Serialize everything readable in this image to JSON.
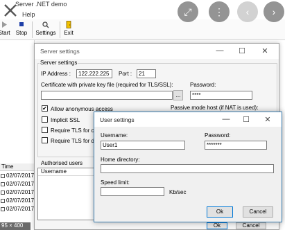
{
  "app": {
    "title": "Server .NET demo",
    "menu_help": "Help",
    "toolbar": {
      "start": "Start",
      "stop": "Stop",
      "settings": "Settings",
      "exit": "Exit"
    },
    "log": {
      "time_header": "Time",
      "rows": [
        "02/07/2017",
        "02/07/2017",
        "02/07/2017",
        "02/07/2017",
        "02/07/2017"
      ]
    },
    "size_tag": "95 × 400"
  },
  "server_settings": {
    "title": "Server settings",
    "group_label": "Server settings",
    "ip_label": "IP Address :",
    "ip_value": "122.222.225",
    "port_label": "Port :",
    "port_value": "21",
    "cert_label": "Certificate with private key file (required for TLS/SSL):",
    "cert_value": "",
    "browse_label": "...",
    "cert_password_label": "Password:",
    "cert_password_value": "****",
    "anon_label": "Allow anonymous access",
    "anon_checked": "✔",
    "passive_label": "Passive mode host (if NAT is used):",
    "implicit_label": "Implicit SSL",
    "require_tls_1": "Require TLS for c",
    "require_tls_2": "Require TLS for d",
    "users_label": "Authorised users",
    "users_column": "Username",
    "ok_label": "Ok",
    "cancel_label": "Cancel"
  },
  "user_settings": {
    "title": "User settings",
    "username_label": "Username:",
    "username_value": "User1",
    "password_label": "Password:",
    "password_value": "*******",
    "home_label": "Home directory:",
    "home_value": "",
    "speed_label": "Speed limit:",
    "speed_value": "",
    "speed_unit": "Kb/sec",
    "ok_label": "Ok",
    "cancel_label": "Cancel"
  },
  "colors": {
    "focus_border": "#0078d7",
    "dialog_border": "#3c7fb1",
    "overlay_button": "#3c3c3c"
  }
}
